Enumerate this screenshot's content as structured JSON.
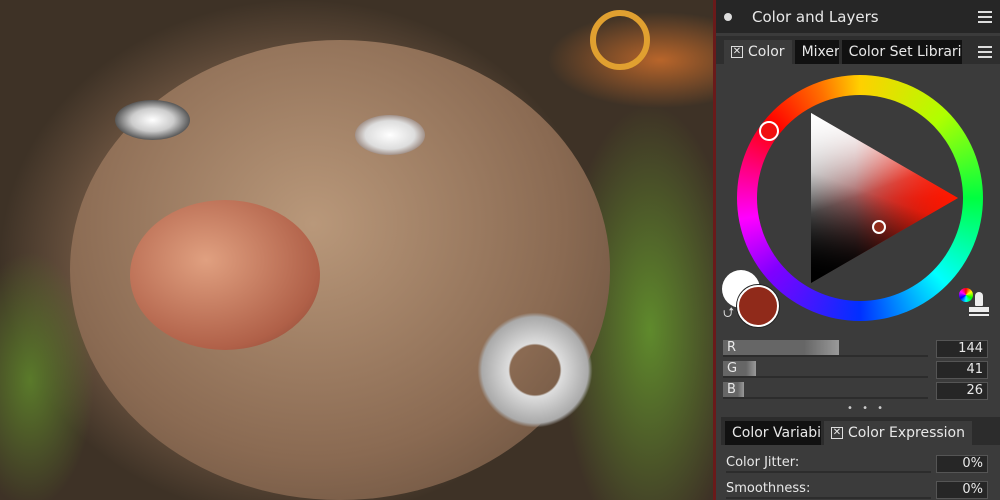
{
  "panel": {
    "title": "Color and Layers",
    "tabs": [
      {
        "label": "Color",
        "active": true
      },
      {
        "label": "Mixer",
        "active": false
      },
      {
        "label": "Color Set Libraries",
        "active": false
      }
    ],
    "color": {
      "main_hex": "#902a1a",
      "additional_hex": "#ffffff",
      "hue_hex": "#ff1a00"
    },
    "rgb": [
      {
        "label": "R",
        "value": "144",
        "fraction": 0.565
      },
      {
        "label": "G",
        "value": "41",
        "fraction": 0.161
      },
      {
        "label": "B",
        "value": "26",
        "fraction": 0.102
      }
    ],
    "more": "• • •",
    "tabs2": [
      {
        "label": "Color Variability",
        "active": false
      },
      {
        "label": "Color Expression",
        "active": true
      }
    ],
    "props": [
      {
        "label": "Color Jitter:",
        "value": "0%"
      },
      {
        "label": "Smoothness:",
        "value": "0%"
      }
    ]
  }
}
